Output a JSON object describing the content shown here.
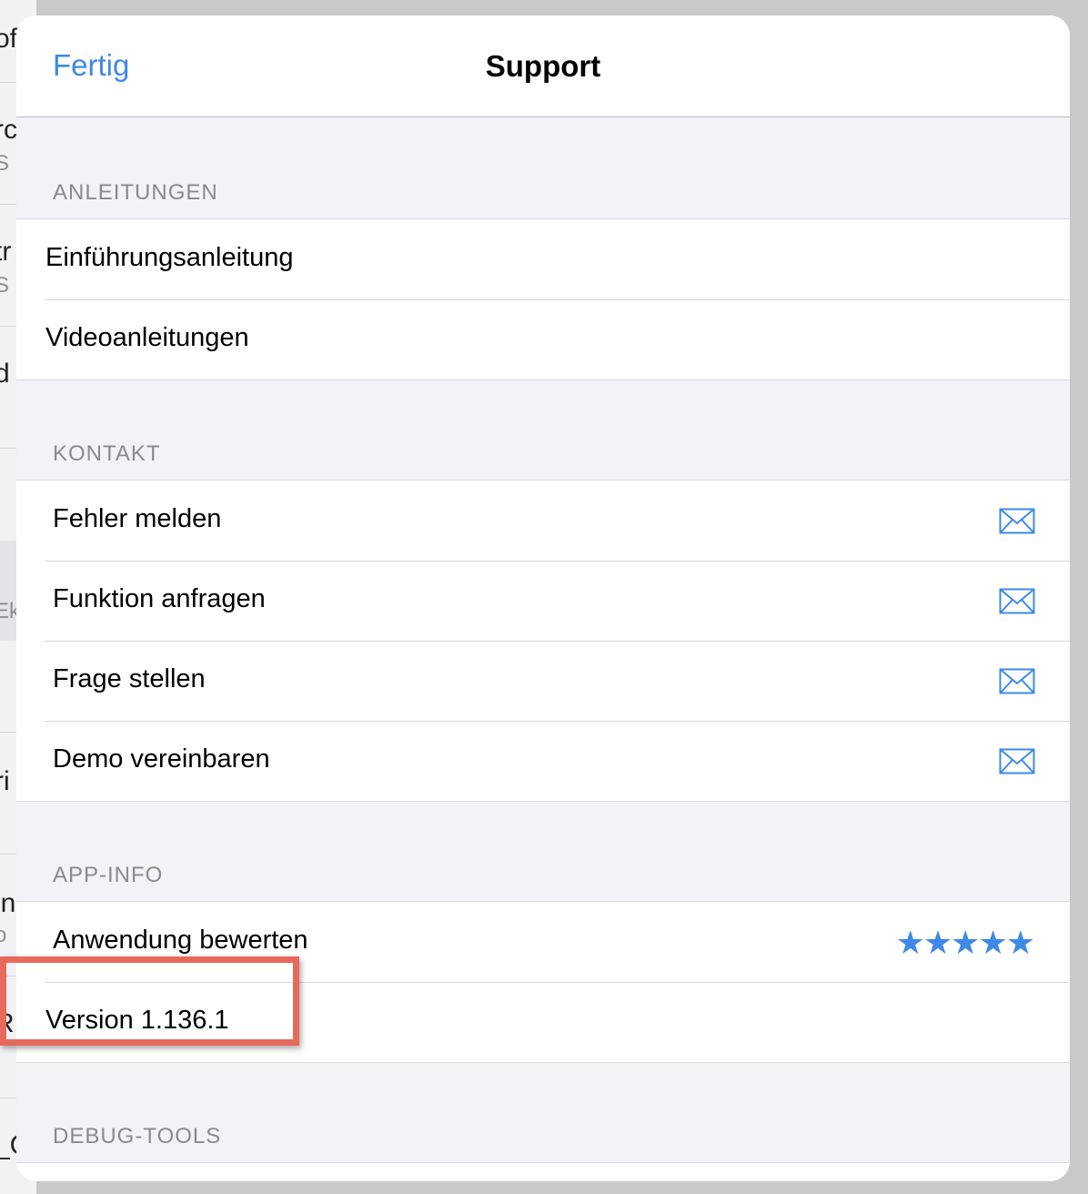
{
  "navbar": {
    "done_label": "Fertig",
    "title": "Support"
  },
  "background_fragments": [
    "of",
    "rc",
    "S",
    "tr",
    "S",
    "d",
    "Ek",
    "ri",
    "in",
    "o",
    "R",
    "_C"
  ],
  "sections": {
    "guides": {
      "header": "ANLEITUNGEN",
      "items": [
        {
          "label": "Einführungsanleitung"
        },
        {
          "label": "Videoanleitungen"
        }
      ]
    },
    "contact": {
      "header": "KONTAKT",
      "items": [
        {
          "label": "Fehler melden",
          "icon": "mail-icon"
        },
        {
          "label": "Funktion anfragen",
          "icon": "mail-icon"
        },
        {
          "label": "Frage stellen",
          "icon": "mail-icon"
        },
        {
          "label": "Demo vereinbaren",
          "icon": "mail-icon"
        }
      ]
    },
    "app_info": {
      "header": "APP-INFO",
      "rate_label": "Anwendung bewerten",
      "rating": {
        "stars": 5,
        "max": 5,
        "glyphs": "★★★★★"
      },
      "version_label": "Version 1.136.1"
    },
    "debug": {
      "header": "DEBUG-TOOLS"
    }
  },
  "colors": {
    "accent": "#3f89e6",
    "highlight": "#e8695a",
    "grouped_bg": "#f2f2f7"
  }
}
